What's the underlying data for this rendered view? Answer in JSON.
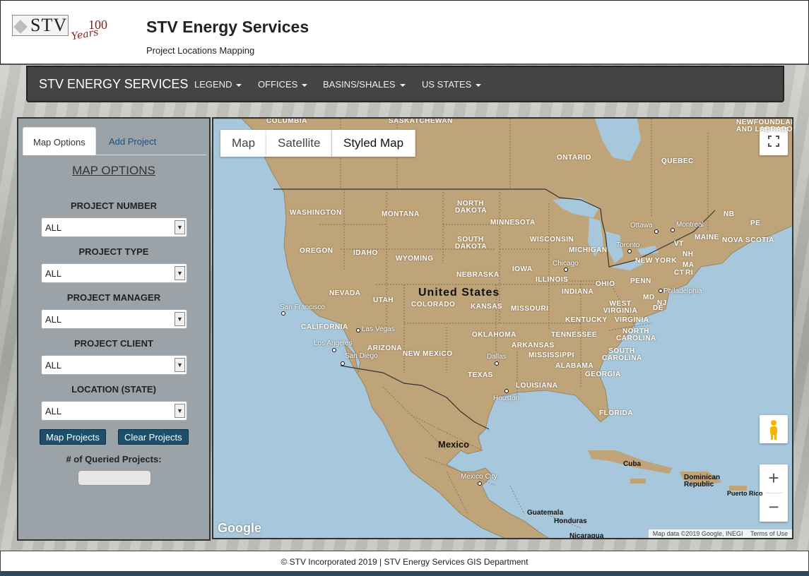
{
  "header": {
    "logo_text": "STV",
    "logo_hundred": "100",
    "logo_years": "Years",
    "title": "STV Energy Services",
    "subtitle": "Project Locations Mapping"
  },
  "navbar": {
    "brand": "STV ENERGY SERVICES",
    "menus": [
      "LEGEND",
      "OFFICES",
      "BASINS/SHALES",
      "US STATES"
    ]
  },
  "sidebar": {
    "tabs": [
      "Map Options",
      "Add Project"
    ],
    "title": "MAP OPTIONS",
    "filters": [
      {
        "label": "PROJECT NUMBER",
        "value": "ALL"
      },
      {
        "label": "PROJECT TYPE",
        "value": "ALL"
      },
      {
        "label": "PROJECT MANAGER",
        "value": "ALL"
      },
      {
        "label": "PROJECT CLIENT",
        "value": "ALL"
      },
      {
        "label": "LOCATION (STATE)",
        "value": "ALL"
      }
    ],
    "map_button": "Map Projects",
    "clear_button": "Clear Projects",
    "count_label": "# of Queried Projects:"
  },
  "map": {
    "types": [
      "Map",
      "Satellite",
      "Styled Map"
    ],
    "selected_type": "Styled Map",
    "google": "Google",
    "attribution": "Map data ©2019 Google, INEGI",
    "terms": "Terms of Use",
    "zoom_in": "+",
    "zoom_out": "−",
    "country_label": "United States",
    "mexico_label": "Mexico",
    "states": [
      "WASHINGTON",
      "MONTANA",
      "NORTH DAKOTA",
      "MINNESOTA",
      "OREGON",
      "IDAHO",
      "WYOMING",
      "SOUTH DAKOTA",
      "WISCONSIN",
      "MICHIGAN",
      "NEBRASKA",
      "IOWA",
      "NEVADA",
      "UTAH",
      "COLORADO",
      "KANSAS",
      "ILLINOIS",
      "INDIANA",
      "OHIO",
      "PENN",
      "CALIFORNIA",
      "MISSOURI",
      "WEST VIRGINIA",
      "VIRGINIA",
      "KENTUCKY",
      "ARIZONA",
      "NEW MEXICO",
      "OKLAHOMA",
      "TENNESSEE",
      "NORTH CAROLINA",
      "ARKANSAS",
      "MISSISSIPPI",
      "ALABAMA",
      "SOUTH CAROLINA",
      "GEORGIA",
      "TEXAS",
      "LOUISIANA",
      "FLORIDA",
      "NEW YORK",
      "MAINE",
      "NH",
      "VT",
      "MA",
      "CT",
      "RI",
      "NJ",
      "MD",
      "DE",
      "ONTARIO",
      "QUEBEC",
      "NB",
      "PE",
      "NOVA SCOTIA",
      "COLUMBIA",
      "SASKATCHEWAN",
      "NEWFOUNDLAND AND LABRADOR"
    ],
    "cities": [
      "San Francisco",
      "Las Vegas",
      "Los Angeles",
      "San Diego",
      "Dallas",
      "Houston",
      "Chicago",
      "Toronto",
      "Ottawa",
      "Montreal",
      "Philadelphia",
      "Mexico City"
    ],
    "dark_labels": [
      "Cuba",
      "Dominican Republic",
      "Puerto Rico",
      "Guatemala",
      "Honduras",
      "Nicaragua"
    ]
  },
  "footer": {
    "text": "© STV Incorporated 2019 | STV Energy Services GIS Department"
  }
}
